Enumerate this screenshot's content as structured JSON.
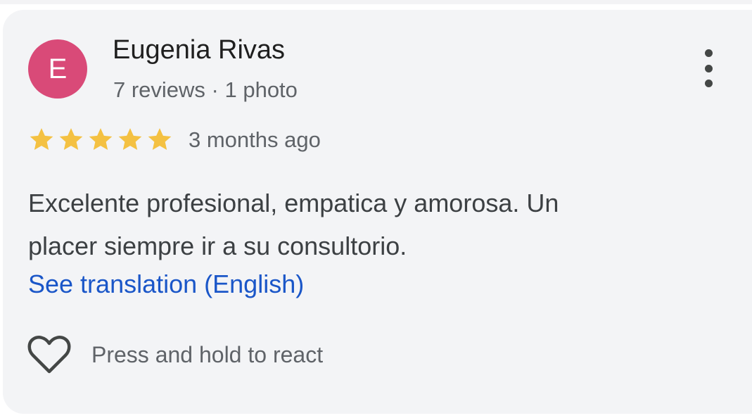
{
  "review": {
    "avatar_initial": "E",
    "avatar_color": "#d94a78",
    "author_name": "Eugenia Rivas",
    "author_meta": "7 reviews · 1 photo",
    "menu_icon": "more-vert-icon",
    "rating": 5,
    "rating_max": 5,
    "star_color": "#f4c142",
    "time_ago": "3 months ago",
    "text_lines": [
      "Excelente profesional, empatica y amorosa. Un",
      "placer siempre ir a su consultorio."
    ],
    "translate_link": "See translation (English)",
    "link_color": "#1a56c8",
    "react_icon": "heart-outline-icon",
    "react_label": "Press and hold to react"
  }
}
